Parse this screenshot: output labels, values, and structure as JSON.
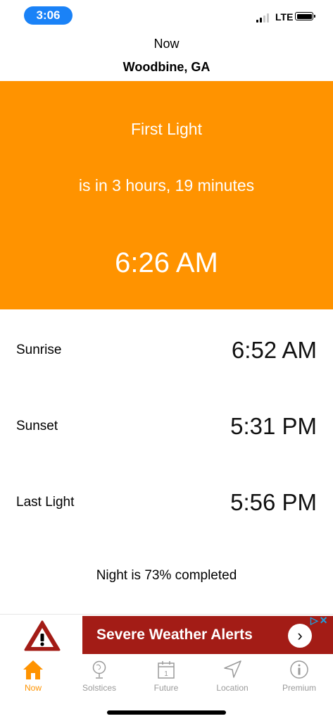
{
  "status_bar": {
    "time": "3:06",
    "network": "LTE"
  },
  "header": {
    "title": "Now",
    "location": "Woodbine, GA"
  },
  "hero": {
    "event": "First Light",
    "countdown": "is in 3 hours, 19 minutes",
    "time": "6:26 AM",
    "color": "#ff9300"
  },
  "rows": [
    {
      "label": "Sunrise",
      "time": "6:52 AM"
    },
    {
      "label": "Sunset",
      "time": "5:31 PM"
    },
    {
      "label": "Last Light",
      "time": "5:56 PM"
    }
  ],
  "progress": {
    "text": "Night is 73% completed",
    "percent": 73
  },
  "ad": {
    "text": "Severe Weather Alerts",
    "background": "#a31c16"
  },
  "tabs": [
    {
      "label": "Now",
      "icon": "home-icon",
      "active": true
    },
    {
      "label": "Solstices",
      "icon": "globe-icon",
      "active": false
    },
    {
      "label": "Future",
      "icon": "calendar-icon",
      "active": false
    },
    {
      "label": "Location",
      "icon": "location-arrow-icon",
      "active": false
    },
    {
      "label": "Premium",
      "icon": "info-icon",
      "active": false
    }
  ],
  "calendar_icon_day": "1"
}
